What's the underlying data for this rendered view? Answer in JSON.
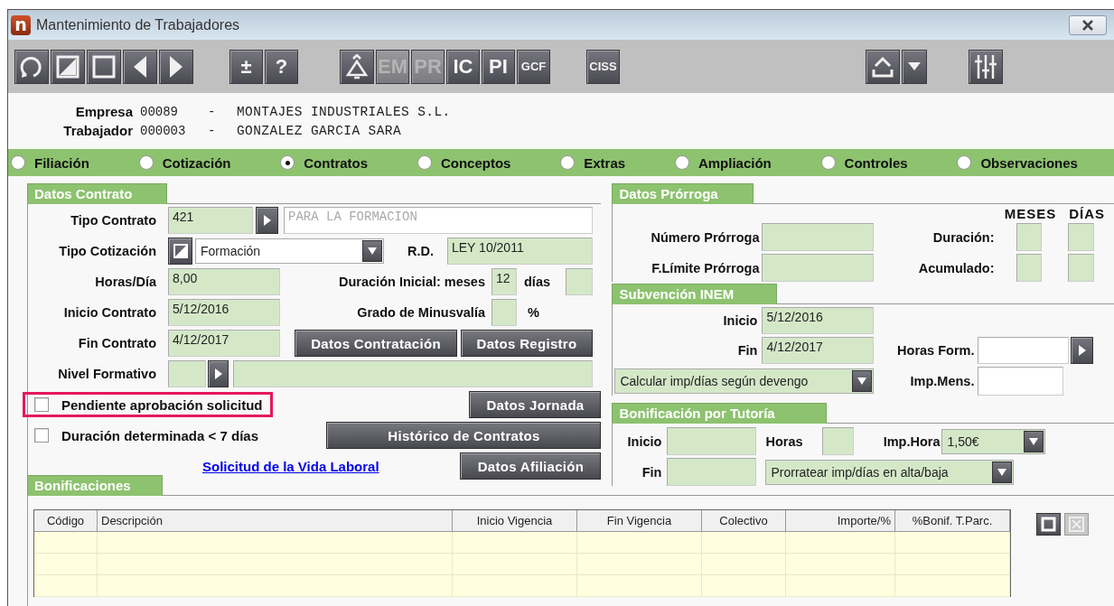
{
  "window": {
    "logo": "n",
    "title": "Mantenimiento de Trabajadores"
  },
  "toolbar": {
    "groups": [
      {
        "buttons": [
          {
            "kind": "refresh",
            "disabled": false
          },
          {
            "kind": "edit",
            "disabled": false
          },
          {
            "kind": "blank",
            "disabled": false
          },
          {
            "kind": "prev",
            "disabled": false
          },
          {
            "kind": "next",
            "disabled": false
          }
        ]
      },
      {
        "buttons": [
          {
            "kind": "text",
            "label": "±",
            "disabled": false
          },
          {
            "kind": "text",
            "label": "?",
            "disabled": false
          }
        ]
      },
      {
        "buttons": [
          {
            "kind": "bell",
            "disabled": false
          },
          {
            "kind": "text",
            "label": "EM",
            "disabled": true
          },
          {
            "kind": "text",
            "label": "PR",
            "disabled": true
          },
          {
            "kind": "text",
            "label": "IC",
            "disabled": false
          },
          {
            "kind": "text",
            "label": "PI",
            "disabled": false
          },
          {
            "kind": "text",
            "label": "GCF",
            "disabled": false
          }
        ]
      },
      {
        "buttons": [
          {
            "kind": "text",
            "label": "CISS",
            "disabled": false
          }
        ]
      },
      {
        "buttons": [
          {
            "kind": "upload",
            "disabled": false
          },
          {
            "kind": "dropdown",
            "disabled": false
          }
        ]
      },
      {
        "buttons": [
          {
            "kind": "sliders",
            "disabled": false
          }
        ]
      }
    ]
  },
  "header": [
    {
      "label": "Empresa",
      "code": "00089",
      "separator": "-",
      "name": "MONTAJES INDUSTRIALES S.L."
    },
    {
      "label": "Trabajador",
      "code": "000003",
      "separator": "-",
      "name": "GONZALEZ GARCIA SARA"
    }
  ],
  "sections": [
    {
      "label": "Filiación",
      "selected": false
    },
    {
      "label": "Cotización",
      "selected": false
    },
    {
      "label": "Contratos",
      "selected": true
    },
    {
      "label": "Conceptos",
      "selected": false
    },
    {
      "label": "Extras",
      "selected": false
    },
    {
      "label": "Ampliación",
      "selected": false
    },
    {
      "label": "Controles",
      "selected": false
    },
    {
      "label": "Observaciones",
      "selected": false
    }
  ],
  "datos_contrato": {
    "title": "Datos Contrato",
    "tipo_contrato": {
      "label": "Tipo Contrato",
      "code": "421",
      "description": "PARA LA FORMACION"
    },
    "tipo_cotizacion": {
      "label": "Tipo Cotización",
      "value": "Formación"
    },
    "rd": {
      "label": "R.D.",
      "value": "LEY 10/2011"
    },
    "horas_dia": {
      "label": "Horas/Día",
      "value": "8,00"
    },
    "duracion_inicial": {
      "label": "Duración Inicial: meses",
      "meses": "12",
      "dias_label": "días"
    },
    "inicio_contrato": {
      "label": "Inicio Contrato",
      "value": "5/12/2016"
    },
    "grado_minusvalia": {
      "label": "Grado de Minusvalía",
      "unit": "%"
    },
    "fin_contrato": {
      "label": "Fin Contrato",
      "value": "4/12/2017"
    },
    "nivel_formativo": {
      "label": "Nivel Formativo"
    },
    "checkboxes": [
      {
        "label": "Pendiente aprobación solicitud",
        "checked": false,
        "highlighted": true
      },
      {
        "label": "Duración determinada < 7 días",
        "checked": false,
        "highlighted": false
      }
    ],
    "buttons": {
      "contratacion": "Datos Contratación",
      "registro": "Datos Registro",
      "jornada": "Datos Jornada",
      "historico": "Histórico de Contratos",
      "afiliacion": "Datos Afiliación"
    },
    "link": "Solicitud de la Vida Laboral"
  },
  "datos_prorroga": {
    "title": "Datos Prórroga",
    "meses_header": "MESES",
    "dias_header": "DÍAS",
    "numero_label": "Número Prórroga",
    "limite_label": "F.Límite Prórroga",
    "duracion_label": "Duración:",
    "acumulado_label": "Acumulado:"
  },
  "subvencion_inem": {
    "title": "Subvención INEM",
    "inicio_label": "Inicio",
    "inicio": "5/12/2016",
    "fin_label": "Fin",
    "fin": "4/12/2017",
    "horas_form_label": "Horas Form.",
    "calculo": "Calcular imp/días según devengo",
    "imp_mens_label": "Imp.Mens."
  },
  "bonificacion_tutoria": {
    "title": "Bonificación por Tutoría",
    "inicio_label": "Inicio",
    "fin_label": "Fin",
    "horas_label": "Horas",
    "imp_hora_label": "Imp.Hora",
    "imp_hora": "1,50€",
    "prorrateo": "Prorratear imp/días en alta/baja"
  },
  "bonificaciones": {
    "title": "Bonificaciones",
    "columns": [
      "Código",
      "Descripción",
      "Inicio Vigencia",
      "Fin Vigencia",
      "Colectivo",
      "Importe/%",
      "%Bonif. T.Parc."
    ],
    "tools": [
      {
        "kind": "add",
        "disabled": false
      },
      {
        "kind": "delete",
        "disabled": true
      }
    ]
  }
}
